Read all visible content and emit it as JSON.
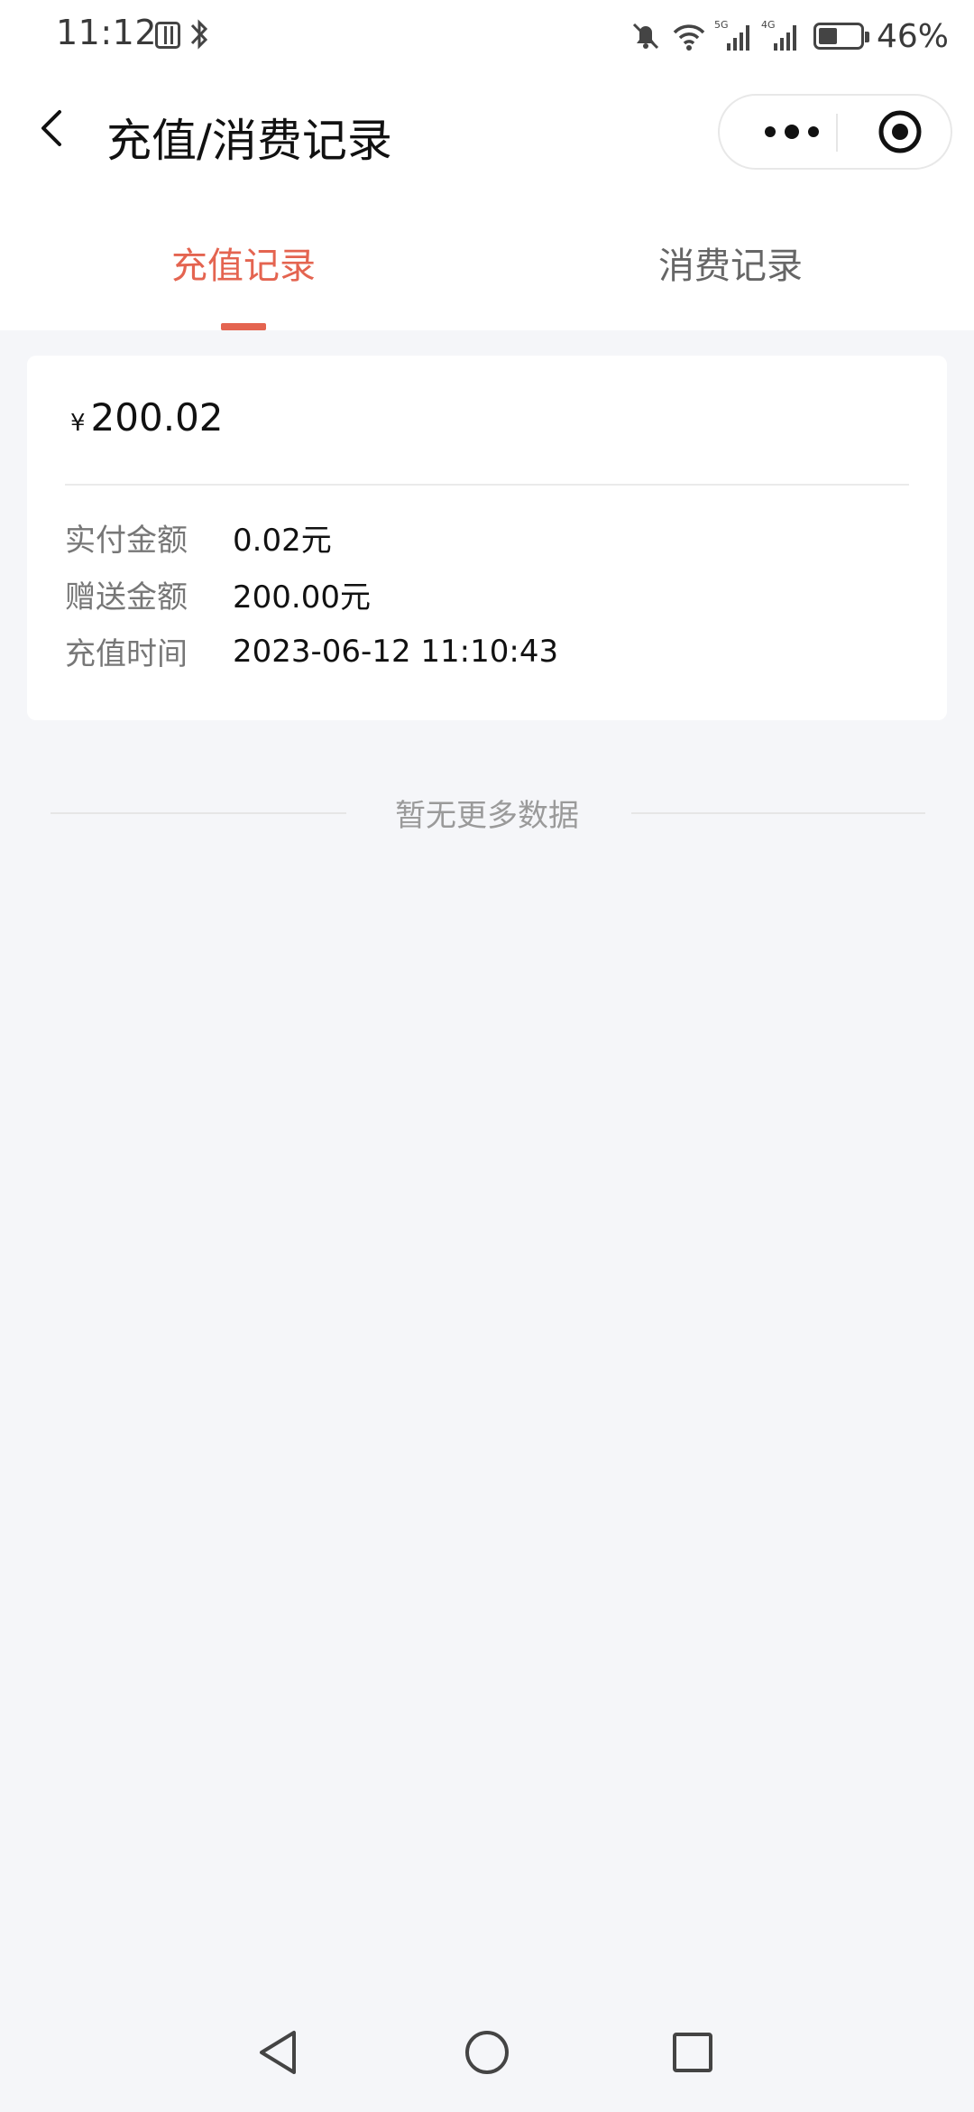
{
  "status_bar": {
    "time": "11:12",
    "battery_percent_text": "46%",
    "battery_level": 0.46,
    "network_labels": [
      "5G",
      "4G"
    ],
    "icons": [
      "nfc-icon",
      "bluetooth-icon",
      "muted-bell-icon",
      "wifi-icon",
      "signal-icon",
      "signal-icon",
      "battery-icon"
    ]
  },
  "nav": {
    "title": "充值/消费记录",
    "back_icon": "chevron-left-icon",
    "capsule_icons": [
      "more-dots-icon",
      "close-target-icon"
    ]
  },
  "tabs": [
    {
      "label": "充值记录",
      "active": true
    },
    {
      "label": "消费记录",
      "active": false
    }
  ],
  "record": {
    "currency_symbol": "¥",
    "amount": "200.02",
    "rows": [
      {
        "label": "实付金额",
        "value": "0.02元"
      },
      {
        "label": "赠送金额",
        "value": "200.00元"
      },
      {
        "label": "充值时间",
        "value": "2023-06-12 11:10:43"
      }
    ]
  },
  "footer_note": "暂无更多数据",
  "system_nav": [
    "back-triangle-icon",
    "home-circle-icon",
    "recents-square-icon"
  ],
  "colors": {
    "accent": "#e46450",
    "page_bg": "#f5f6f9",
    "card_bg": "#ffffff",
    "muted_text": "#777777"
  }
}
